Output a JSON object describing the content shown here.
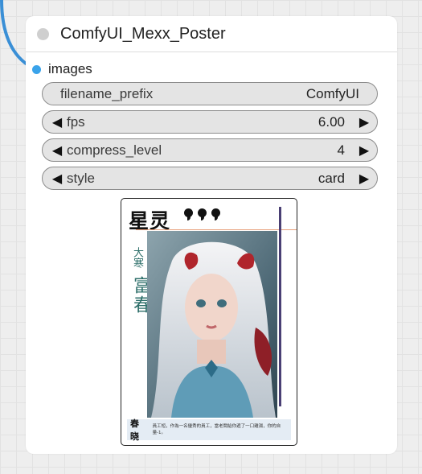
{
  "node": {
    "title": "ComfyUI_Mexx_Poster",
    "input_label": "images",
    "widgets": [
      {
        "label": "filename_prefix",
        "value": "ComfyUI"
      },
      {
        "label": "fps",
        "value": "6.00"
      },
      {
        "label": "compress_level",
        "value": "4"
      },
      {
        "label": "style",
        "value": "card"
      }
    ]
  },
  "poster": {
    "title": "星灵",
    "side_small": "大寒",
    "side_big": "富春",
    "footer_name": "春晓",
    "footer_text": "員工短，作為一名優秀的員工，當老闆給你遞了一口雞湯，你的自量-1。"
  },
  "colors": {
    "canvas": "#eeeeee",
    "node_bg": "#ffffff",
    "input_dot": "#3aa3ea",
    "link_wire": "#3a8fd6",
    "poster_accent": "#2e6f6a"
  }
}
